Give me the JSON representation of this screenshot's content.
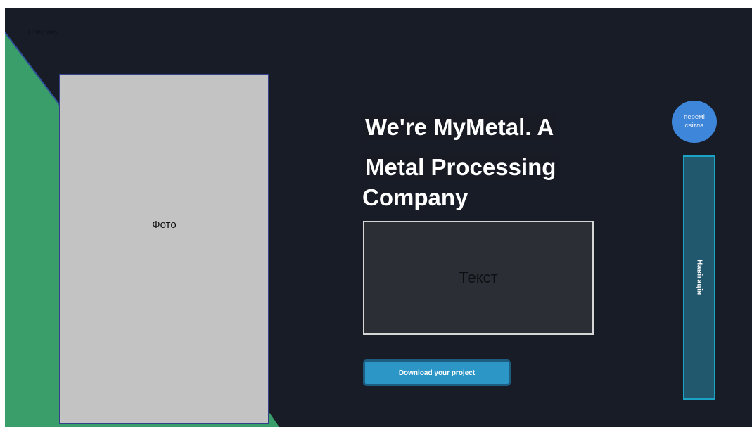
{
  "header": {
    "brand": "Company"
  },
  "hero": {
    "photo_label": "Фото",
    "headline_line1": "We're MyMetal. A",
    "headline_line2": "Metal Processing",
    "headline_line3": "Company",
    "text_placeholder": "Текст",
    "download_label": "Download your project"
  },
  "side": {
    "theme_toggle_line1": "перемі",
    "theme_toggle_line2": "світла",
    "nav_label": "Навігація"
  },
  "colors": {
    "background": "#171c26",
    "accent_green": "#3a9e6a",
    "button_blue": "#2c96c6",
    "toggle_blue": "#3e86da",
    "nav_teal": "#22586d"
  }
}
